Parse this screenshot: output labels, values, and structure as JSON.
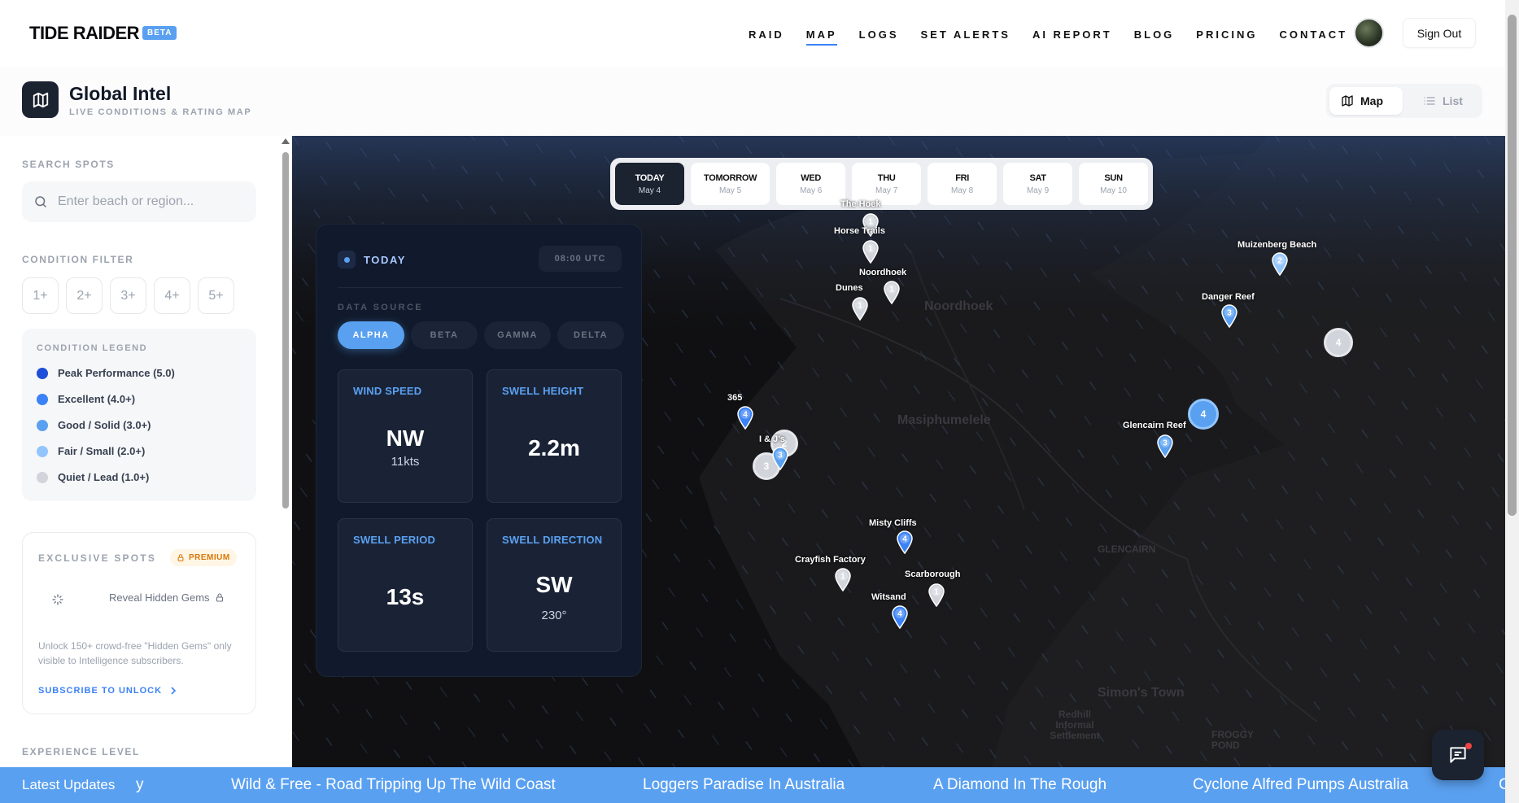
{
  "brand": {
    "name": "TIDE RAIDER",
    "badge": "BETA"
  },
  "nav": {
    "items": [
      {
        "label": "RAID"
      },
      {
        "label": "MAP"
      },
      {
        "label": "LOGS"
      },
      {
        "label": "SET ALERTS"
      },
      {
        "label": "AI REPORT"
      },
      {
        "label": "BLOG"
      },
      {
        "label": "PRICING"
      },
      {
        "label": "CONTACT"
      }
    ],
    "active": "MAP",
    "signout": "Sign Out"
  },
  "header": {
    "title": "Global Intel",
    "subtitle": "LIVE CONDITIONS & RATING MAP",
    "view_map": "Map",
    "view_list": "List"
  },
  "sidebar": {
    "search_label": "SEARCH SPOTS",
    "search_placeholder": "Enter beach or region...",
    "filter_label": "CONDITION FILTER",
    "filters": [
      "1+",
      "2+",
      "3+",
      "4+",
      "5+"
    ],
    "legend_title": "CONDITION LEGEND",
    "legend": [
      {
        "label": "Peak Performance (5.0)",
        "color": "#1d4ed8"
      },
      {
        "label": "Excellent (4.0+)",
        "color": "#3b82f6"
      },
      {
        "label": "Good / Solid (3.0+)",
        "color": "#5aa0f0"
      },
      {
        "label": "Fair / Small (2.0+)",
        "color": "#93c5fd"
      },
      {
        "label": "Quiet / Lead (1.0+)",
        "color": "#d1d5db"
      }
    ],
    "exclusive": {
      "title": "EXCLUSIVE SPOTS",
      "badge": "PREMIUM",
      "reveal": "Reveal Hidden Gems",
      "description": "Unlock 150+ crowd-free \"Hidden Gems\" only visible to Intelligence subscribers.",
      "cta": "SUBSCRIBE TO UNLOCK"
    },
    "experience_label": "EXPERIENCE LEVEL"
  },
  "days": [
    {
      "day": "TODAY",
      "date": "May 4"
    },
    {
      "day": "TOMORROW",
      "date": "May 5"
    },
    {
      "day": "WED",
      "date": "May 6"
    },
    {
      "day": "THU",
      "date": "May 7"
    },
    {
      "day": "FRI",
      "date": "May 8"
    },
    {
      "day": "SAT",
      "date": "May 9"
    },
    {
      "day": "SUN",
      "date": "May 10"
    }
  ],
  "conditions": {
    "day": "TODAY",
    "time": "08:00 UTC",
    "data_source_label": "DATA SOURCE",
    "sources": [
      "ALPHA",
      "BETA",
      "GAMMA",
      "DELTA"
    ],
    "active_source": "ALPHA",
    "wind_speed": {
      "label": "WIND SPEED",
      "value": "NW",
      "sub": "11kts"
    },
    "swell_height": {
      "label": "SWELL HEIGHT",
      "value": "2.2m"
    },
    "swell_period": {
      "label": "SWELL PERIOD",
      "value": "13s"
    },
    "swell_direction": {
      "label": "SWELL DIRECTION",
      "value": "SW",
      "sub": "230°"
    }
  },
  "map_labels": [
    "Noordhoek",
    "Masiphumelele",
    "GLENCAIRN",
    "Simon's Town",
    "Redhill Informal Settlement",
    "FROGGY POND"
  ],
  "spots": [
    {
      "name": "The Hoek",
      "rating": 1
    },
    {
      "name": "Horse Trails",
      "rating": 1
    },
    {
      "name": "Noordhoek",
      "rating": 1
    },
    {
      "name": "Dunes",
      "rating": 1
    },
    {
      "name": "Muizenberg Beach",
      "rating": 2
    },
    {
      "name": "Danger Reef",
      "rating": 3
    },
    {
      "name": "365",
      "rating": 4
    },
    {
      "name": "I & J's",
      "rating": 3
    },
    {
      "name": "Glencairn Reef",
      "rating": 3
    },
    {
      "name": "Misty Cliffs",
      "rating": 4
    },
    {
      "name": "Crayfish Factory",
      "rating": 1
    },
    {
      "name": "Scarborough",
      "rating": 1
    },
    {
      "name": "Witsand",
      "rating": 4
    }
  ],
  "clusters": [
    {
      "count": "2"
    },
    {
      "count": "3"
    },
    {
      "count": "4"
    },
    {
      "count": "4"
    }
  ],
  "ticker": {
    "label": "Latest Updates",
    "items": [
      "y",
      "Wild & Free - Road Tripping Up The Wild Coast",
      "Loggers Paradise In Australia",
      "A Diamond In The Rough",
      "Cyclone Alfred Pumps Australia",
      "C"
    ]
  },
  "colors": {
    "accent": "#5aa0f0",
    "dark": "#1b2230",
    "premium": "#d97706",
    "map_bg": "#141416"
  }
}
